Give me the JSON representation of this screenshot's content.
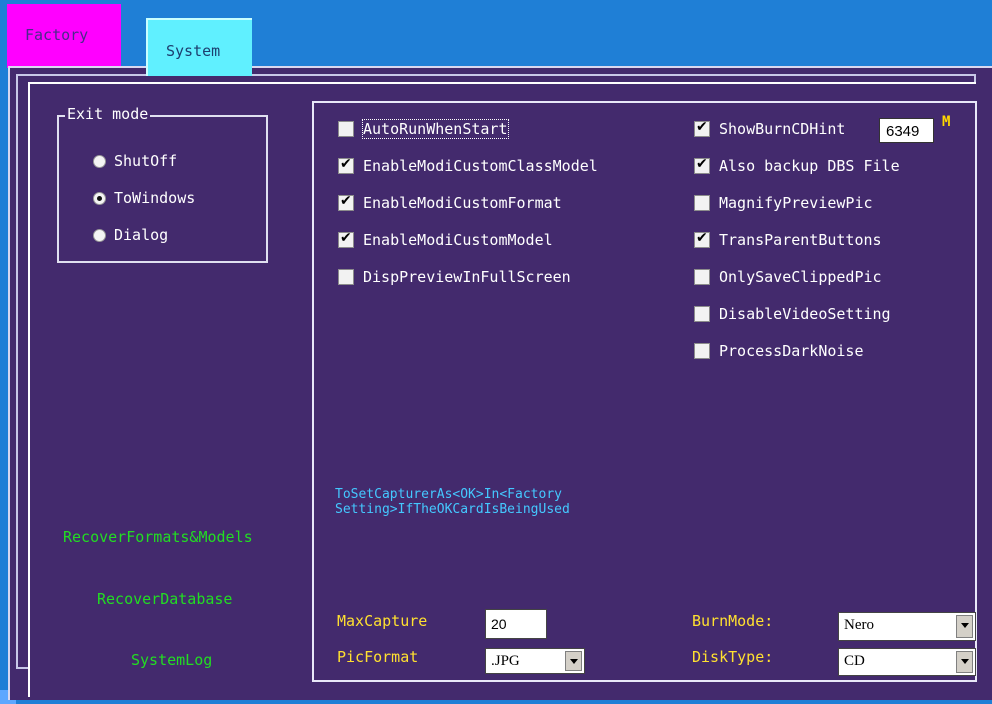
{
  "tabs": [
    {
      "label": "Factory"
    },
    {
      "label": "System"
    }
  ],
  "exit_mode": {
    "title": "Exit mode",
    "options": [
      {
        "label": "ShutOff",
        "selected": false
      },
      {
        "label": "ToWindows",
        "selected": true
      },
      {
        "label": "Dialog",
        "selected": false
      }
    ]
  },
  "options_left": [
    {
      "label": "AutoRunWhenStart",
      "checked": false
    },
    {
      "label": "EnableModiCustomClassModel",
      "checked": true
    },
    {
      "label": "EnableModiCustomFormat",
      "checked": true
    },
    {
      "label": "EnableModiCustomModel",
      "checked": true
    },
    {
      "label": "DispPreviewInFullScreen",
      "checked": false
    }
  ],
  "options_right": [
    {
      "label": "ShowBurnCDHint",
      "checked": true
    },
    {
      "label": "Also backup DBS File",
      "checked": true
    },
    {
      "label": "MagnifyPreviewPic",
      "checked": false
    },
    {
      "label": "TransParentButtons",
      "checked": true
    },
    {
      "label": "OnlySaveClippedPic",
      "checked": false
    },
    {
      "label": "DisableVideoSetting",
      "checked": false
    },
    {
      "label": "ProcessDarkNoise",
      "checked": false
    }
  ],
  "burn_hint": {
    "value": "6349",
    "unit": "M"
  },
  "capturer_note": "ToSetCapturerAs<OK>In<Factory\nSetting>IfTheOKCardIsBeingUsed",
  "links": {
    "recover_formats": "RecoverFormats&Models",
    "recover_database": "RecoverDatabase",
    "system_log": "SystemLog"
  },
  "fields": {
    "max_capture_label": "MaxCapture",
    "max_capture_value": "20",
    "pic_format_label": "PicFormat",
    "pic_format_value": ".JPG",
    "burn_mode_label": "BurnMode:",
    "burn_mode_value": "Nero",
    "disk_type_label": "DiskType:",
    "disk_type_value": "CD"
  },
  "colors": {
    "panel": "#432a6d",
    "window_bg": "#1f7fd6",
    "factory_tab": "#ff00ff",
    "system_tab": "#60f0ff",
    "link_green": "#22dd22",
    "label_yellow": "#ffe030",
    "note_cyan": "#44c8ff"
  }
}
